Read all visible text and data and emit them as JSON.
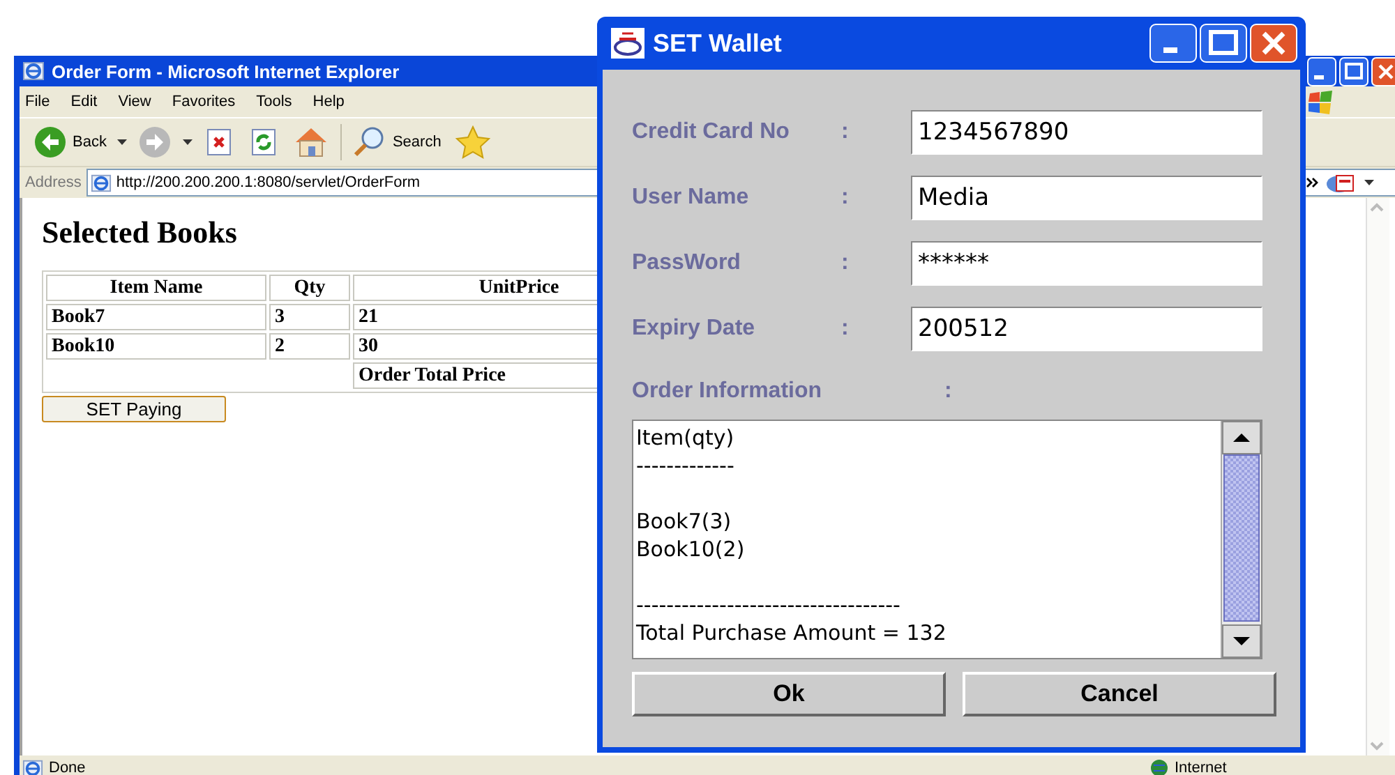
{
  "browser": {
    "title": "Order Form - Microsoft Internet Explorer",
    "menu": [
      "File",
      "Edit",
      "View",
      "Favorites",
      "Tools",
      "Help"
    ],
    "toolbar": [
      {
        "kind": "back",
        "label": "Back"
      },
      {
        "kind": "forward"
      },
      {
        "kind": "stop"
      },
      {
        "kind": "refresh"
      },
      {
        "kind": "home"
      },
      {
        "kind": "search",
        "label": "Search"
      },
      {
        "kind": "favorites"
      }
    ],
    "address_label": "Address",
    "address": "http://200.200.200.1:8080/servlet/OrderForm",
    "page": {
      "heading": "Selected Books",
      "table": {
        "columns": [
          "Item Name",
          "Qty",
          "UnitPrice"
        ],
        "rows": [
          [
            "Book7",
            "3",
            "21"
          ],
          [
            "Book10",
            "2",
            "30"
          ]
        ],
        "total_label": "Order Total Price"
      },
      "button": "SET Paying"
    },
    "status_bar": {
      "text": "Done",
      "zone": "Internet"
    }
  },
  "dialog": {
    "title": "SET Wallet",
    "fields": [
      {
        "label": "Credit Card No",
        "colon": ":",
        "value": "1234567890"
      },
      {
        "label": "User Name",
        "colon": ":",
        "value": "Media"
      },
      {
        "label": "PassWord",
        "colon": ":",
        "value": "******"
      },
      {
        "label": "Expiry Date",
        "colon": ":",
        "value": "200512"
      }
    ],
    "order_label": "Order Information",
    "order_colon": ":",
    "order_text": [
      [
        "Item(qty)",
        "-------------"
      ],
      [
        "Book7(3)",
        "Book10(2)"
      ],
      [
        "-----------------------------------",
        "Total Purchase Amount = 132"
      ]
    ],
    "buttons": [
      "Ok",
      "Cancel"
    ]
  }
}
